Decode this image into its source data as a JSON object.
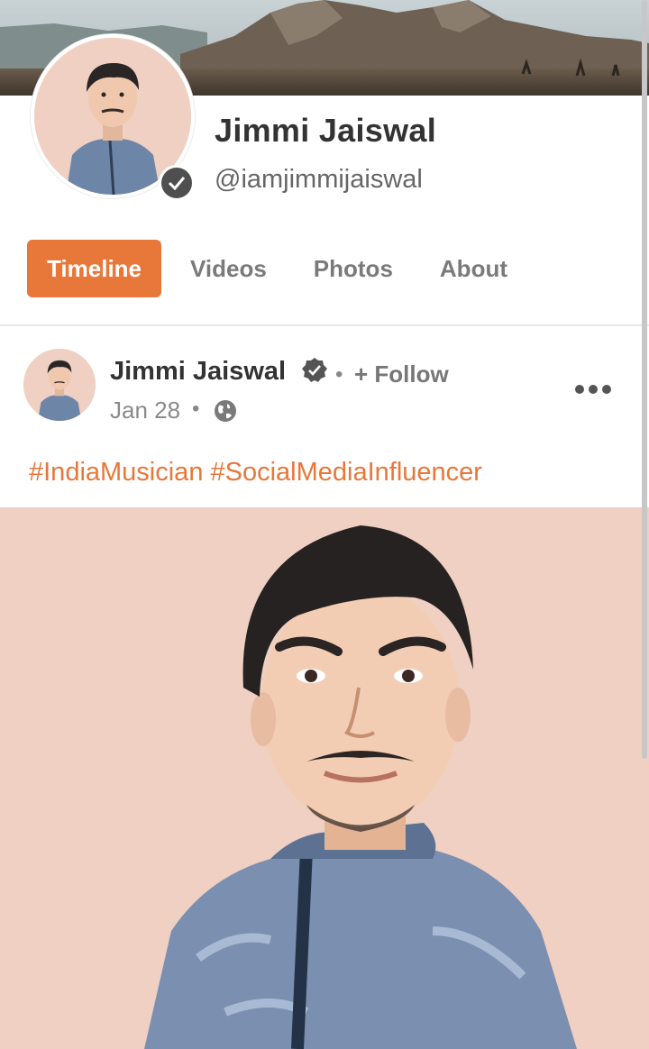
{
  "profile": {
    "name": "Jimmi Jaiswal",
    "handle": "@iamjimmijaiswal"
  },
  "tabs": [
    {
      "label": "Timeline",
      "active": true
    },
    {
      "label": "Videos",
      "active": false
    },
    {
      "label": "Photos",
      "active": false
    },
    {
      "label": "About",
      "active": false
    }
  ],
  "post": {
    "author": "Jimmi Jaiswal",
    "separator": "•",
    "follow_label": "+ Follow",
    "date": "Jan 28",
    "text": "#IndiaMusician #SocialMediaInfluencer",
    "privacy_icon": "globe-icon"
  },
  "colors": {
    "accent": "#e8773a",
    "image_background": "#efd0c2",
    "badge": "#4f4f4f"
  },
  "icons": {
    "verified": "verified-badge-icon",
    "more": "more-options-icon"
  }
}
